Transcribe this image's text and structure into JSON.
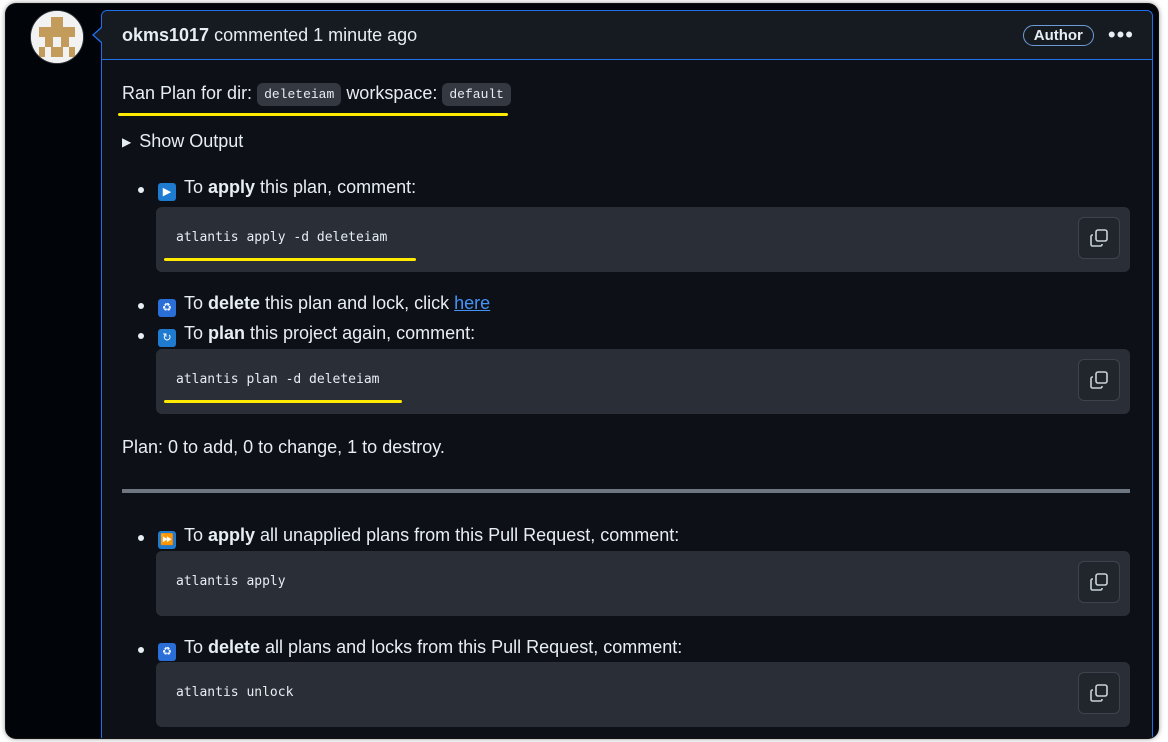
{
  "comment": {
    "author": "okms1017",
    "action": "commented 1 minute ago",
    "badge": "Author",
    "menu_glyph": "•••"
  },
  "body": {
    "ran_plan": {
      "prefix": "Ran Plan for dir:",
      "dir": "deleteiam",
      "workspace_label": "workspace:",
      "workspace": "default"
    },
    "show_output": "Show Output",
    "apply_item": {
      "pre": "To ",
      "bold": "apply",
      "post": " this plan, comment:",
      "code": "atlantis apply -d deleteiam"
    },
    "delete_item": {
      "pre": "To ",
      "bold": "delete",
      "post": " this plan and lock, click ",
      "link": "here"
    },
    "plan_item": {
      "pre": "To ",
      "bold": "plan",
      "post": " this project again, comment:",
      "code": "atlantis plan -d deleteiam"
    },
    "plan_summary": "Plan: 0 to add, 0 to change, 1 to destroy.",
    "apply_all_item": {
      "pre": "To ",
      "bold": "apply",
      "post": " all unapplied plans from this Pull Request, comment:",
      "code": "atlantis apply"
    },
    "delete_all_item": {
      "pre": "To ",
      "bold": "delete",
      "post": " all plans and locks from this Pull Request, comment:",
      "code": "atlantis unlock"
    }
  },
  "colors": {
    "background": "#0d1117",
    "header": "#161b22",
    "accent_border": "#1f6feb",
    "link": "#4493f8",
    "highlight": "#ffea00",
    "code_block": "#2a2f37"
  },
  "icons": [
    "play-button-icon",
    "fast-forward-icon",
    "put-litter-in-bin-icon",
    "repeat-icon",
    "copy-icon",
    "kebab-menu-icon",
    "disclosure-triangle-icon"
  ]
}
